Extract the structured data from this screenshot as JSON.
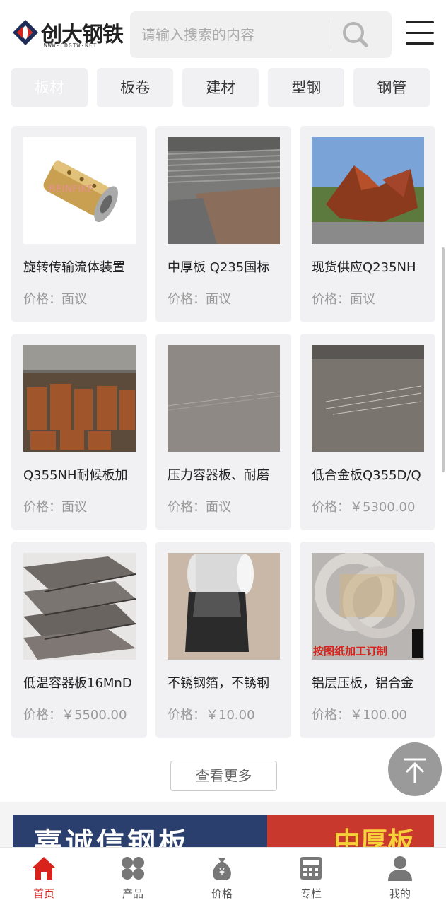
{
  "header": {
    "logo_text": "创大钢铁",
    "logo_sub": "WWW·CDGTW·NET",
    "search_placeholder": "请输入搜索的内容"
  },
  "tabs": [
    {
      "label": "板材",
      "active": true
    },
    {
      "label": "板卷",
      "active": false
    },
    {
      "label": "建材",
      "active": false
    },
    {
      "label": "型钢",
      "active": false
    },
    {
      "label": "钢管",
      "active": false
    }
  ],
  "products": [
    {
      "name": "旋转传输流体装置",
      "price": "价格：面议",
      "thumb_text": "BEINFIKE"
    },
    {
      "name": "中厚板 Q235国标",
      "price": "价格：面议"
    },
    {
      "name": "现货供应Q235NH",
      "price": "价格：面议"
    },
    {
      "name": "Q355NH耐候板加",
      "price": "价格：面议"
    },
    {
      "name": "压力容器板、耐磨",
      "price": "价格：面议"
    },
    {
      "name": "低合金板Q355D/Q",
      "price": "价格：￥5300.00"
    },
    {
      "name": "低温容器板16MnD",
      "price": "价格：￥5500.00"
    },
    {
      "name": "不锈钢箔，不锈钢",
      "price": "价格：￥10.00"
    },
    {
      "name": "铝层压板，铝合金",
      "price": "价格：￥100.00",
      "thumb_text": "按图纸加工订制"
    }
  ],
  "more_label": "查看更多",
  "banner": {
    "left_text": "嘉诚信钢板",
    "right_text": "中厚板"
  },
  "bottom_nav": [
    {
      "label": "首页",
      "icon": "home-icon",
      "active": true
    },
    {
      "label": "产品",
      "icon": "grid-icon",
      "active": false
    },
    {
      "label": "价格",
      "icon": "money-bag-icon",
      "active": false
    },
    {
      "label": "专栏",
      "icon": "calculator-icon",
      "active": false
    },
    {
      "label": "我的",
      "icon": "user-icon",
      "active": false
    }
  ],
  "colors": {
    "brand_red": "#d8221c",
    "card_bg": "#f1f1f3",
    "price_gray": "#999999"
  }
}
